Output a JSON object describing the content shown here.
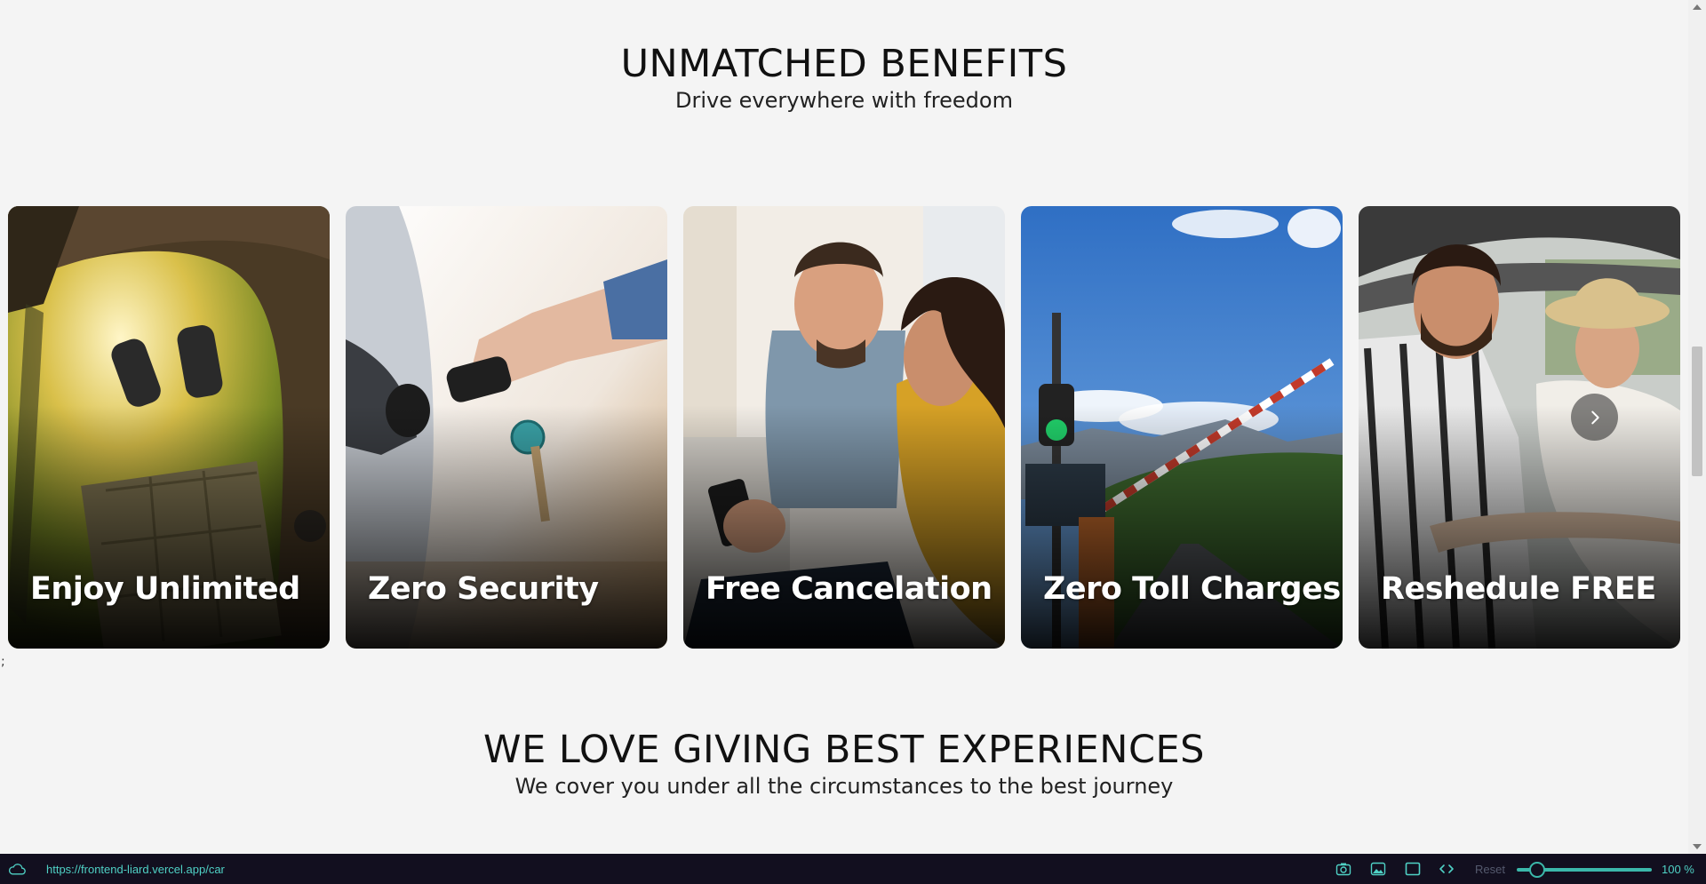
{
  "benefits": {
    "title": "UNMATCHED BENEFITS",
    "subtitle": "Drive everywhere with freedom",
    "cards": [
      {
        "title": "Enjoy Unlimited"
      },
      {
        "title": "Zero Security"
      },
      {
        "title": "Free Cancelation"
      },
      {
        "title": "Zero Toll Charges"
      },
      {
        "title": "Reshedule FREE"
      }
    ]
  },
  "stray_text": ";",
  "experiences": {
    "title": "WE LOVE GIVING BEST EXPERIENCES",
    "subtitle": "We cover you under all the circumstances to the best journey"
  },
  "statusbar": {
    "url": "https://frontend-liard.vercel.app/car",
    "reset_label": "Reset",
    "zoom": "100 %",
    "zoom_level": 0.15
  },
  "icons": {
    "status": "cloud-icon",
    "carousel_next": "chevron-right-icon",
    "tools": [
      "camera-icon",
      "image-icon",
      "frame-icon",
      "code-icon"
    ]
  },
  "colors": {
    "page_bg": "#f4f4f4",
    "statusbar_bg": "#120f1f",
    "accent": "#4fd1c5"
  }
}
